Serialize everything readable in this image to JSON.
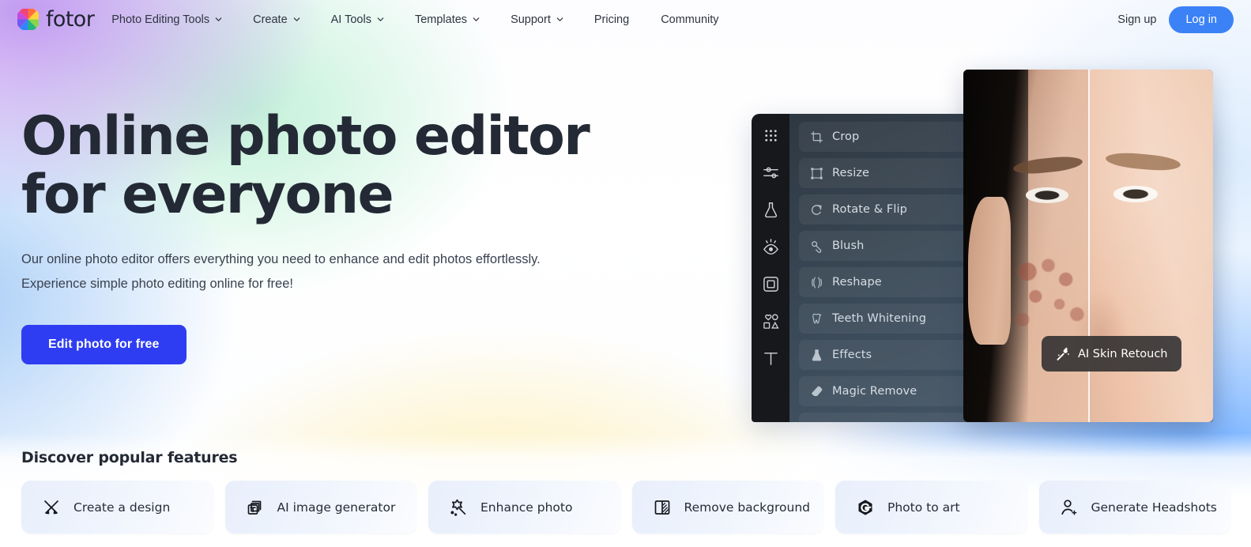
{
  "brand": {
    "name": "fotor",
    "logo_icon": "color-wheel-icon"
  },
  "nav": {
    "items": [
      {
        "label": "Photo Editing Tools",
        "has_caret": true
      },
      {
        "label": "Create",
        "has_caret": true
      },
      {
        "label": "AI Tools",
        "has_caret": true
      },
      {
        "label": "Templates",
        "has_caret": true
      },
      {
        "label": "Support",
        "has_caret": true
      },
      {
        "label": "Pricing",
        "has_caret": false
      },
      {
        "label": "Community",
        "has_caret": false
      }
    ],
    "signup_label": "Sign up",
    "login_label": "Log in",
    "login_color": "#3b82f6"
  },
  "hero": {
    "heading": "Online photo editor for everyone",
    "subtitle_line1": "Our online photo editor offers everything you need to enhance and edit photos effortlessly.",
    "subtitle_line2": "Experience simple photo editing online for free!",
    "cta_label": "Edit photo for free",
    "cta_color": "#2f3df2"
  },
  "editor": {
    "rail_icons": [
      "dot-grid-icon",
      "sliders-icon",
      "flask-icon",
      "eye-icon",
      "frame-icon",
      "shapes-icon",
      "text-icon"
    ],
    "tools": [
      {
        "label": "Crop",
        "icon": "crop-icon"
      },
      {
        "label": "Resize",
        "icon": "resize-icon"
      },
      {
        "label": "Rotate & Flip",
        "icon": "rotate-icon"
      },
      {
        "label": "Blush",
        "icon": "blush-icon"
      },
      {
        "label": "Reshape",
        "icon": "reshape-icon"
      },
      {
        "label": "Teeth Whitening",
        "icon": "tooth-icon"
      },
      {
        "label": "Effects",
        "icon": "effects-icon"
      },
      {
        "label": "Magic Remove",
        "icon": "eraser-icon"
      }
    ],
    "badge_label": "AI Skin Retouch",
    "badge_icon": "magic-wand-icon"
  },
  "features": {
    "heading": "Discover popular features",
    "cards": [
      {
        "label": "Create a design",
        "icon": "pencil-ruler-icon"
      },
      {
        "label": "AI image generator",
        "icon": "image-stack-icon"
      },
      {
        "label": "Enhance photo",
        "icon": "sparkle-wand-icon"
      },
      {
        "label": "Remove background",
        "icon": "bg-remove-icon"
      },
      {
        "label": "Photo to art",
        "icon": "hexagon-g-icon"
      },
      {
        "label": "Generate Headshots",
        "icon": "person-plus-icon"
      }
    ]
  }
}
